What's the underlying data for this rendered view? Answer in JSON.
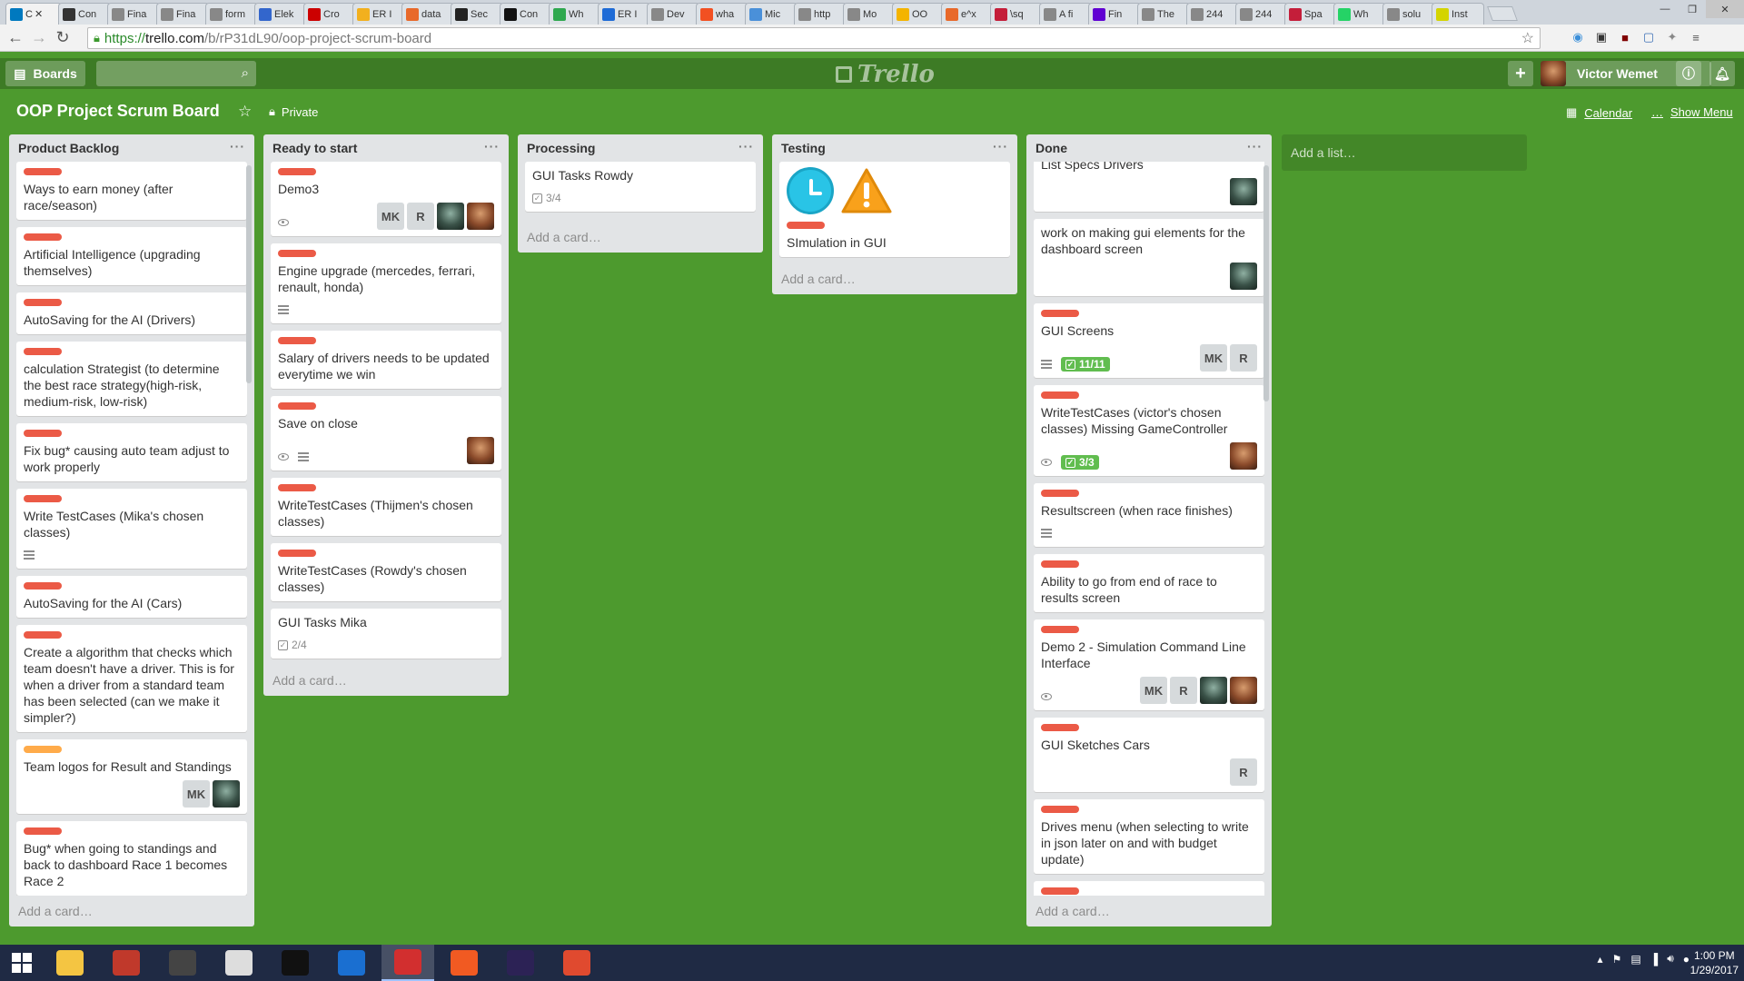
{
  "browser": {
    "tabs": [
      {
        "label": "C",
        "color": "#0079bf",
        "active": true
      },
      {
        "label": "Con",
        "color": "#333333"
      },
      {
        "label": "Fina",
        "color": "#888888"
      },
      {
        "label": "Fina",
        "color": "#888888"
      },
      {
        "label": "form",
        "color": "#888888"
      },
      {
        "label": "Elek",
        "color": "#3366cc"
      },
      {
        "label": "Cro",
        "color": "#cc0000"
      },
      {
        "label": "ER I",
        "color": "#f2b01e"
      },
      {
        "label": "data",
        "color": "#e8692a"
      },
      {
        "label": "Sec",
        "color": "#222222"
      },
      {
        "label": "Con",
        "color": "#111111"
      },
      {
        "label": "Wh",
        "color": "#2fa84f"
      },
      {
        "label": "ER I",
        "color": "#1e6bd6"
      },
      {
        "label": "Dev",
        "color": "#888888"
      },
      {
        "label": "wha",
        "color": "#f25022"
      },
      {
        "label": "Mic",
        "color": "#4a90d9"
      },
      {
        "label": "http",
        "color": "#888888"
      },
      {
        "label": "Mo",
        "color": "#888888"
      },
      {
        "label": "OO",
        "color": "#f4b400"
      },
      {
        "label": "e^x",
        "color": "#e8692a"
      },
      {
        "label": "\\sq",
        "color": "#c41e3a"
      },
      {
        "label": "A fi",
        "color": "#888888"
      },
      {
        "label": "Fin",
        "color": "#6001d2"
      },
      {
        "label": "The",
        "color": "#888888"
      },
      {
        "label": "244",
        "color": "#888888"
      },
      {
        "label": "244",
        "color": "#888888"
      },
      {
        "label": "Spa",
        "color": "#c41e3a"
      },
      {
        "label": "Wh",
        "color": "#25d366"
      },
      {
        "label": "solu",
        "color": "#888888"
      },
      {
        "label": "Inst",
        "color": "#d4d400"
      }
    ],
    "url": {
      "scheme": "https://",
      "host": "trello.com",
      "path": "/b/rP31dL90/oop-project-scrum-board"
    }
  },
  "header": {
    "boards_label": "Boards",
    "user_name": "Victor Wemet",
    "logo_text": "Trello"
  },
  "board": {
    "title": "OOP Project Scrum Board",
    "visibility": "Private",
    "calendar_label": "Calendar",
    "menu_label": "Show Menu",
    "add_list_label": "Add a list…",
    "add_card_label": "Add a card…"
  },
  "lists": [
    {
      "name": "Product Backlog",
      "cards": [
        {
          "labels": [
            "red"
          ],
          "title": "Ways to earn money (after race/season)"
        },
        {
          "labels": [
            "red"
          ],
          "title": "Artificial Intelligence (upgrading themselves)"
        },
        {
          "labels": [
            "red"
          ],
          "title": "AutoSaving for the AI (Drivers)"
        },
        {
          "labels": [
            "red"
          ],
          "title": "calculation Strategist (to determine the best race strategy(high-risk, medium-risk, low-risk)"
        },
        {
          "labels": [
            "red"
          ],
          "title": "Fix bug* causing auto team adjust to work properly"
        },
        {
          "labels": [
            "red"
          ],
          "title": "Write TestCases (Mika's chosen classes)",
          "desc": true
        },
        {
          "labels": [
            "red"
          ],
          "title": "AutoSaving for the AI (Cars)"
        },
        {
          "labels": [
            "red"
          ],
          "title": "Create a algorithm that checks which team doesn't have a driver. This is for when a driver from a standard team has been selected (can we make it simpler?)"
        },
        {
          "labels": [
            "orange"
          ],
          "title": "Team logos for Result and Standings",
          "members": [
            "MK",
            "photo-a"
          ]
        },
        {
          "labels": [
            "red"
          ],
          "title": "Bug* when going to standings and back to dashboard Race 1 becomes Race 2"
        }
      ]
    },
    {
      "name": "Ready to start",
      "cards": [
        {
          "labels": [
            "red"
          ],
          "title": "Demo3",
          "watch": true,
          "members": [
            "MK",
            "R",
            "photo-a",
            "photo-b"
          ]
        },
        {
          "labels": [
            "red"
          ],
          "title": "Engine upgrade (mercedes, ferrari, renault, honda)",
          "desc": true
        },
        {
          "labels": [
            "red"
          ],
          "title": "Salary of drivers needs to be updated everytime we win"
        },
        {
          "labels": [
            "red"
          ],
          "title": "Save on close",
          "watch": true,
          "desc": true,
          "members": [
            "photo-b"
          ]
        },
        {
          "labels": [
            "red"
          ],
          "title": "WriteTestCases (Thijmen's chosen classes)"
        },
        {
          "labels": [
            "red"
          ],
          "title": "WriteTestCases (Rowdy's chosen classes)"
        },
        {
          "labels": [],
          "title": "GUI Tasks Mika",
          "checklist": "2/4"
        }
      ]
    },
    {
      "name": "Processing",
      "cards": [
        {
          "labels": [],
          "title": "GUI Tasks Rowdy",
          "checklist": "3/4"
        }
      ]
    },
    {
      "name": "Testing",
      "cards": [
        {
          "labels": [
            "red"
          ],
          "title": "SImulation in GUI",
          "stickers": [
            "clock",
            "warning"
          ]
        }
      ]
    },
    {
      "name": "Done",
      "cards": [
        {
          "labels": [],
          "title": "List Specs Drivers",
          "members": [
            "photo-a"
          ]
        },
        {
          "labels": [],
          "title": "work on making gui elements for the dashboard screen",
          "members": [
            "photo-a"
          ]
        },
        {
          "labels": [
            "red"
          ],
          "title": "GUI Screens",
          "desc": true,
          "checklist_done": "11/11",
          "members": [
            "MK",
            "R"
          ]
        },
        {
          "labels": [
            "red"
          ],
          "title": "WriteTestCases (victor's chosen classes) Missing GameController",
          "watch": true,
          "checklist_done": "3/3",
          "members": [
            "photo-b"
          ]
        },
        {
          "labels": [
            "red"
          ],
          "title": "Resultscreen (when race finishes)",
          "desc": true
        },
        {
          "labels": [
            "red"
          ],
          "title": "Ability to go from end of race to results screen"
        },
        {
          "labels": [
            "red"
          ],
          "title": "Demo 2 - Simulation Command Line Interface",
          "watch": true,
          "members": [
            "MK",
            "R",
            "photo-a",
            "photo-b"
          ]
        },
        {
          "labels": [
            "red"
          ],
          "title": "GUI Sketches Cars",
          "members": [
            "R"
          ]
        },
        {
          "labels": [
            "red"
          ],
          "title": "Drives menu (when selecting to write in json later on and with budget update)"
        },
        {
          "labels": [
            "red"
          ],
          "title": ""
        }
      ]
    }
  ],
  "taskbar": {
    "apps": [
      {
        "name": "file-explorer",
        "color": "#f4c542"
      },
      {
        "name": "game-app",
        "color": "#c0392b"
      },
      {
        "name": "steam-dark-app",
        "color": "#444444"
      },
      {
        "name": "steam-app",
        "color": "#dddddd"
      },
      {
        "name": "sound-blaster-app",
        "color": "#111111"
      },
      {
        "name": "photoshop-app",
        "color": "#1a6fd1"
      },
      {
        "name": "opera-app",
        "color": "#d22f2f",
        "active": true
      },
      {
        "name": "brave-app",
        "color": "#f15a22"
      },
      {
        "name": "eclipse-app",
        "color": "#2c2255"
      },
      {
        "name": "intellij-app",
        "color": "#e04a2f"
      }
    ],
    "time": "1:00 PM",
    "date": "1/29/2017"
  }
}
